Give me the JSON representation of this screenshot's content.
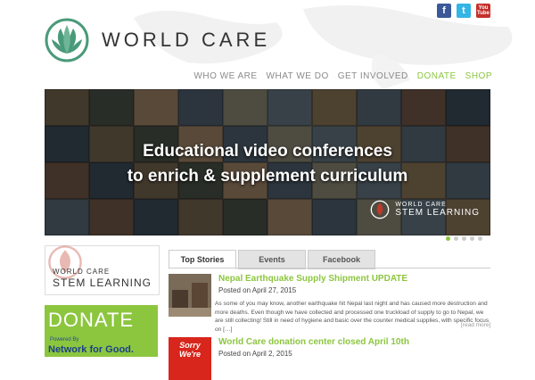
{
  "header": {
    "brand": "WORLD CARE",
    "social": [
      {
        "icon": "facebook-icon",
        "glyph": "f",
        "color": "#3b5998"
      },
      {
        "icon": "twitter-icon",
        "glyph": "t",
        "color": "#33b5e5"
      },
      {
        "icon": "youtube-icon",
        "glyph": "You Tube",
        "color": "#c4302b"
      }
    ],
    "nav": [
      "WHO WE ARE",
      "WHAT WE DO",
      "GET INVOLVED",
      "DONATE",
      "SHOP"
    ]
  },
  "banner": {
    "line1": "Educational video conferences",
    "line2": "to enrich & supplement curriculum",
    "brand_small": "WORLD CARE",
    "brand_large": "STEM LEARNING",
    "dots": 5,
    "active_dot": 0
  },
  "sidebar": {
    "stem_line1": "WORLD CARE",
    "stem_line2": "STEM LEARNING",
    "donate": "DONATE",
    "powered_by": "Powered By",
    "network": "Network for Good."
  },
  "tabs": [
    "Top Stories",
    "Events",
    "Facebook"
  ],
  "stories": [
    {
      "title": "Nepal Earthquake Supply Shipment UPDATE",
      "date": "Posted on April 27, 2015",
      "excerpt": "As some of you may know, another earthquake hit Nepal last night and has caused more destruction and more deaths. Even though we have collected and processed one truckload of supply to go to Nepal, we are still collecting! Still in need of hygiene and basic over the counter medical supplies, with specific focus on […]"
    },
    {
      "title": "World Care donation center closed April 10th",
      "date": "Posted on April 2, 2015",
      "thumb_text": "Sorry We're"
    }
  ],
  "read_more": "[read more]",
  "colors": {
    "accent": "#8cc63f",
    "logo": "#4a9a7a"
  }
}
